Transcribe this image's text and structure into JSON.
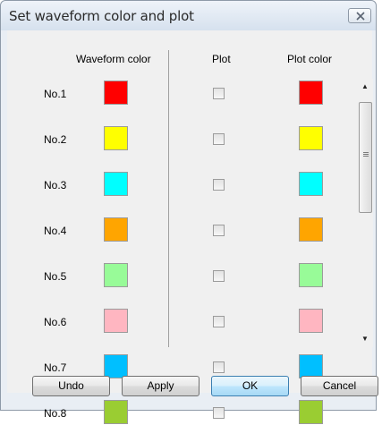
{
  "window": {
    "title": "Set waveform color and plot"
  },
  "header": {
    "waveform_color": "Waveform color",
    "plot": "Plot",
    "plot_color": "Plot color"
  },
  "rows": [
    {
      "label": "No.1",
      "waveform_color": "#ff0000",
      "plot_checked": false,
      "plot_color": "#ff0000"
    },
    {
      "label": "No.2",
      "waveform_color": "#ffff00",
      "plot_checked": false,
      "plot_color": "#ffff00"
    },
    {
      "label": "No.3",
      "waveform_color": "#00ffff",
      "plot_checked": false,
      "plot_color": "#00ffff"
    },
    {
      "label": "No.4",
      "waveform_color": "#ffa500",
      "plot_checked": false,
      "plot_color": "#ffa500"
    },
    {
      "label": "No.5",
      "waveform_color": "#98fb98",
      "plot_checked": false,
      "plot_color": "#98fb98"
    },
    {
      "label": "No.6",
      "waveform_color": "#ffb6c1",
      "plot_checked": false,
      "plot_color": "#ffb6c1"
    },
    {
      "label": "No.7",
      "waveform_color": "#00bfff",
      "plot_checked": false,
      "plot_color": "#00bfff"
    },
    {
      "label": "No.8",
      "waveform_color": "#9acd32",
      "plot_checked": false,
      "plot_color": "#9acd32"
    }
  ],
  "buttons": {
    "undo": "Undo",
    "apply": "Apply",
    "ok": "OK",
    "cancel": "Cancel"
  },
  "icons": {
    "close": "close-icon",
    "scroll_up": "scroll-up-arrow-icon",
    "scroll_down": "scroll-down-arrow-icon"
  }
}
